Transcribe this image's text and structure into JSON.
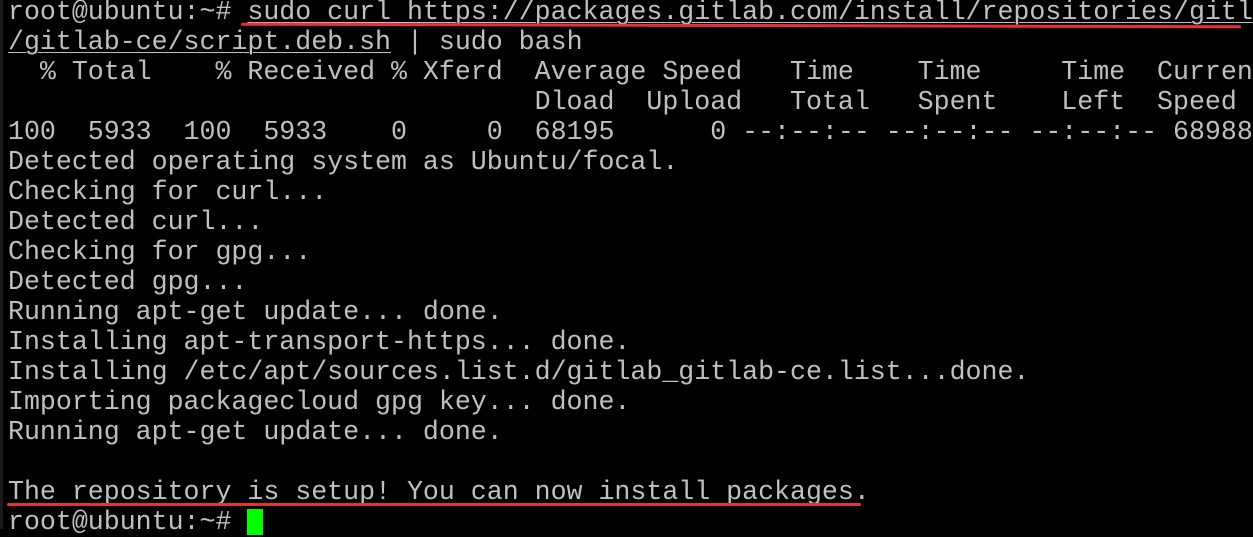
{
  "terminal": {
    "prompt": "root@ubuntu:~# ",
    "command_part1": "sudo curl https://packages.gitlab.com/install/repositories/gitl",
    "command_part2": "/gitlab-ce/script.deb.sh",
    "command_pipe": " | sudo bash",
    "curl_header_1": "  % Total    % Received % Xferd  Average Speed   Time    Time     Time  Current",
    "curl_header_2": "                                 Dload  Upload   Total   Spent    Left  Speed",
    "curl_progress": "100  5933  100  5933    0     0  68195      0 --:--:-- --:--:-- --:--:-- 68988",
    "output_lines": [
      "Detected operating system as Ubuntu/focal.",
      "Checking for curl...",
      "Detected curl...",
      "Checking for gpg...",
      "Detected gpg...",
      "Running apt-get update... done.",
      "Installing apt-transport-https... done.",
      "Installing /etc/apt/sources.list.d/gitlab_gitlab-ce.list...done.",
      "Importing packagecloud gpg key... done.",
      "Running apt-get update... done.",
      ""
    ],
    "success_message": "The repository is setup! You can now install packages.",
    "final_prompt": "root@ubuntu:~# ",
    "colors": {
      "background": "#000000",
      "text": "#c0c0c0",
      "cursor": "#00ff00",
      "annotation": "#e8303a"
    }
  }
}
